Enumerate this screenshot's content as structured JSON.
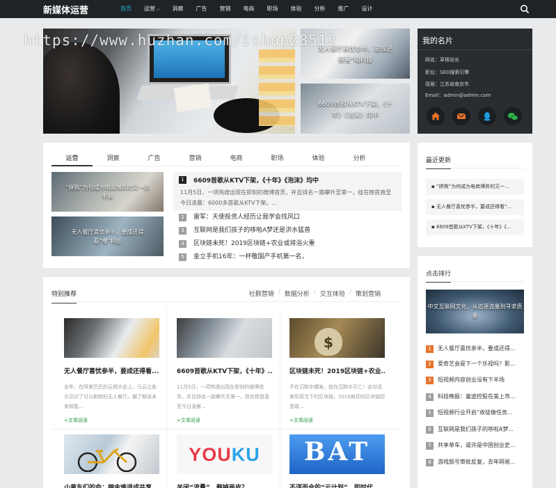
{
  "watermark": "https://www.huzhan.com/ishop28512",
  "header": {
    "logo": "新媒体运营",
    "nav": [
      {
        "label": "首页",
        "active": true
      },
      {
        "label": "运营",
        "dropdown": true
      },
      {
        "label": "洞察"
      },
      {
        "label": "广告"
      },
      {
        "label": "营销"
      },
      {
        "label": "电商"
      },
      {
        "label": "职场"
      },
      {
        "label": "体验"
      },
      {
        "label": "分析"
      },
      {
        "label": "推广"
      },
      {
        "label": "设计"
      }
    ],
    "search_icon": "search-icon"
  },
  "slider": {
    "active_index": 1,
    "dot_count": 5,
    "side": [
      {
        "caption": "无人餐厅喜忧参半，要成还得看“嘲科技"
      },
      {
        "caption": "6609首歌从KTV下架，《十年》《泡沫》均中"
      }
    ]
  },
  "profile": {
    "title": "我的名片",
    "rows": [
      "网名：草根站长",
      "职业：SEO搜索引擎",
      "现居：江苏省南京市",
      "Email：admin@admin.com"
    ],
    "icons": [
      "home-icon",
      "mail-icon",
      "qq-icon",
      "wechat-icon"
    ],
    "icon_color": "#e8732b"
  },
  "tabs": {
    "items": [
      "运营",
      "洞察",
      "广告",
      "营销",
      "电商",
      "职场",
      "体验",
      "分析"
    ],
    "active_index": 0,
    "thumbs": [
      "“拼购”为何成为电商博弈的又一杀手锏",
      "无人餐厅喜忧参半，要成还得看“嘲”科技"
    ],
    "headline": {
      "num": "1",
      "title": "6609首歌从KTV下架，《十年》《泡沫》均中",
      "desc": "11月5日，一项热搜出现在即刻的微博首页，并且排名一路攀升至第一，挂在榜首直至今日凌晨：6000多首歌从KTV下架。..."
    },
    "list": [
      {
        "num": "2",
        "title": "雷军：天使投资人经历让我学会找风口"
      },
      {
        "num": "3",
        "title": "互联网是我们孩子的哆啦A梦还是洪水猛兽"
      },
      {
        "num": "4",
        "title": "区块链未死！2019区块链+农业或将浴火重"
      },
      {
        "num": "5",
        "title": "金立手机16年：一杯敬国产手机第一名，"
      }
    ]
  },
  "recent": {
    "title": "最近更新",
    "items": [
      "“拼购”为何成为电商博弈的又一...",
      "无人餐厅喜忧参半，要成还得看“...",
      "6609首歌从KTV下架，《十年》《..."
    ]
  },
  "featured": {
    "title": "特别推荐",
    "links": [
      "社群营销",
      "数据分析",
      "交互体验",
      "策划营销"
    ],
    "more_label": "+文章阅读",
    "cards": [
      {
        "title": "无人餐厅喜忧参半，要成还得看...",
        "desc": "去年，在阿里巴巴的云栖大会上，马云让各方见识了可以刷脸的无人餐厅。据了解该未来智能..."
      },
      {
        "title": "6609首歌从KTV下架，《十年》...",
        "desc": "11月5日，一项热搜出现在即刻的微博首页，并且排名一路攀升至第一，挂在榜首直至今日凌晨..."
      },
      {
        "title": "区块链未死！2019区块链+农业...",
        "desc": "不在沉默中爆发，就在沉默中灭亡！这句话来形容当下的区块链，2018疯狂的区块链因受政..."
      },
      {
        "title": "小黄车们的命：押金难退成共享...",
        "desc": ""
      },
      {
        "title": "关闭“流量”，删掉画皮？",
        "desc": "",
        "logo_text": "YOUKU"
      },
      {
        "title": "不谋而合的“云计划”，即时代...",
        "desc": "",
        "logo_text": "BAT"
      }
    ]
  },
  "rank": {
    "title": "点击排行",
    "image_caption": "中文互联网文化，从追逐流量到寻求质量",
    "items": [
      {
        "num": "1",
        "title": "无人餐厅喜忧参半，要成还得..."
      },
      {
        "num": "2",
        "title": "爱奇艺会是下一个乐视吗？影..."
      },
      {
        "num": "3",
        "title": "短视频内容创业没有下半场"
      },
      {
        "num": "4",
        "title": "科技晚报：富途控股在美上市..."
      },
      {
        "num": "5",
        "title": "短视频行业开启“收徒做任务..."
      },
      {
        "num": "6",
        "title": "互联网是我们孩子的哆啦A梦..."
      },
      {
        "num": "7",
        "title": "共享单车，或许是中国创业史..."
      },
      {
        "num": "8",
        "title": "游戏版号审批反复，去年网易..."
      }
    ]
  }
}
